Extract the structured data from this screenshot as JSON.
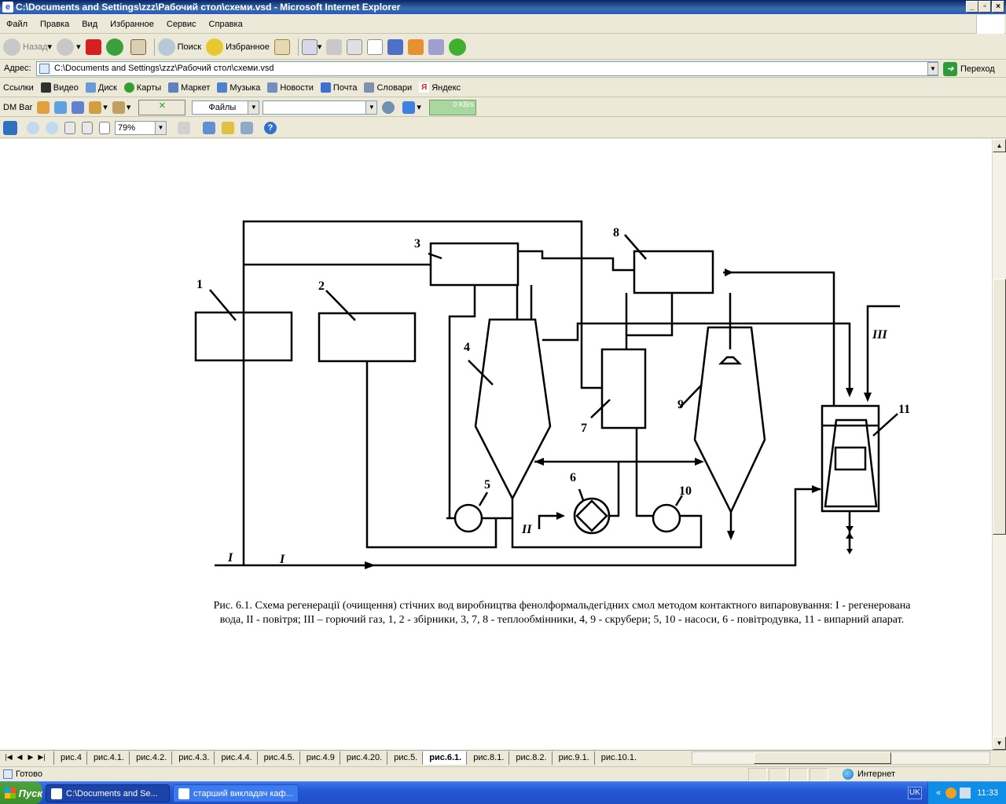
{
  "window": {
    "title": "C:\\Documents and Settings\\zzz\\Рабочий стол\\схеми.vsd - Microsoft Internet Explorer"
  },
  "menu": [
    "Файл",
    "Правка",
    "Вид",
    "Избранное",
    "Сервис",
    "Справка"
  ],
  "toolbar": {
    "back": "Назад",
    "search": "Поиск",
    "favorites": "Избранное"
  },
  "address": {
    "label": "Адрес:",
    "value": "C:\\Documents and Settings\\zzz\\Рабочий стол\\схеми.vsd",
    "go": "Переход"
  },
  "links": {
    "label": "Ссылки",
    "items": [
      "Видео",
      "Диск",
      "Карты",
      "Маркет",
      "Музыка",
      "Новости",
      "Почта",
      "Словари",
      "Яндекс"
    ]
  },
  "dmbar": {
    "label": "DM Bar",
    "files": "Файлы",
    "speed": "0 KB/s"
  },
  "visio": {
    "zoom": "79%"
  },
  "diagram": {
    "labels": [
      "1",
      "2",
      "3",
      "4",
      "5",
      "6",
      "7",
      "8",
      "9",
      "10",
      "11"
    ],
    "streams": [
      "I",
      "I",
      "II",
      "III"
    ],
    "caption": "Рис. 6.1. Схема регенерації (очищення) стічних вод виробництва фенолформальдегідних смол методом контактного випаровування: I - регенерована вода, II - повітря; III – горючий газ, 1, 2 - збірники, 3, 7, 8 - теплообмінники, 4, 9 - скрубери; 5, 10 - насоси, 6 - повітродувка, 11 - випарний апарат."
  },
  "tabs": [
    "рис.4",
    "рис.4.1.",
    "рис.4.2.",
    "рис.4.3.",
    "рис.4.4.",
    "рис.4.5.",
    "рис.4.9",
    "рис.4.20.",
    "рис.5.",
    "рис.6.1.",
    "рис.8.1.",
    "рис.8.2.",
    "рис.9.1.",
    "рис.10.1."
  ],
  "active_tab": "рис.6.1.",
  "status": {
    "text": "Готово",
    "zone": "Интернет"
  },
  "taskbar": {
    "start": "Пуск",
    "tasks": [
      "C:\\Documents and Se...",
      "старший викладач каф..."
    ],
    "lang": "UK",
    "clock": "11:33"
  }
}
